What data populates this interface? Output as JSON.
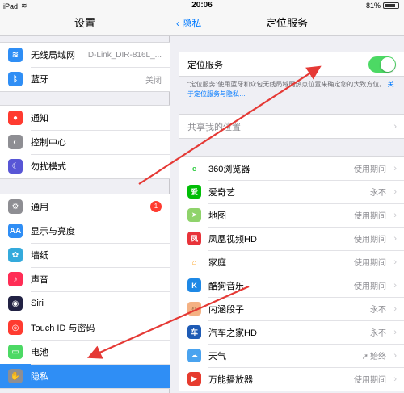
{
  "status": {
    "device": "iPad",
    "time": "20:06",
    "battery": "81%",
    "battery_level": 0.81
  },
  "left": {
    "title": "设置",
    "group1": [
      {
        "name": "wifi",
        "label": "无线局域网",
        "value": "D-Link_DIR-816L_...",
        "color": "#2f8ef5",
        "icon": "wifi-icon",
        "glyph": "≋"
      },
      {
        "name": "bluetooth",
        "label": "蓝牙",
        "value": "关闭",
        "color": "#2f8ef5",
        "icon": "bluetooth-icon",
        "glyph": "ᛒ"
      }
    ],
    "group2": [
      {
        "name": "notifications",
        "label": "通知",
        "color": "#ff3b30",
        "icon": "notifications-icon",
        "glyph": "●"
      },
      {
        "name": "control-center",
        "label": "控制中心",
        "color": "#8e8e93",
        "icon": "control-center-icon",
        "glyph": "◐"
      },
      {
        "name": "do-not-disturb",
        "label": "勿扰模式",
        "color": "#5856d6",
        "icon": "moon-icon",
        "glyph": "☾"
      }
    ],
    "group3": [
      {
        "name": "general",
        "label": "通用",
        "badge": "1",
        "color": "#8e8e93",
        "icon": "gear-icon",
        "glyph": "⚙"
      },
      {
        "name": "display",
        "label": "显示与亮度",
        "color": "#2f8ef5",
        "icon": "display-icon",
        "glyph": "AA"
      },
      {
        "name": "wallpaper",
        "label": "墙纸",
        "color": "#34aadc",
        "icon": "wallpaper-icon",
        "glyph": "✿"
      },
      {
        "name": "sounds",
        "label": "声音",
        "color": "#ff2d55",
        "icon": "sound-icon",
        "glyph": "♪"
      },
      {
        "name": "siri",
        "label": "Siri",
        "color": "#222244",
        "icon": "siri-icon",
        "glyph": "◉"
      },
      {
        "name": "touch-id",
        "label": "Touch ID 与密码",
        "color": "#ff3b30",
        "icon": "fingerprint-icon",
        "glyph": "◎"
      },
      {
        "name": "battery",
        "label": "电池",
        "color": "#4cd964",
        "icon": "battery-icon",
        "glyph": "▭"
      },
      {
        "name": "privacy",
        "label": "隐私",
        "color": "#8e8e93",
        "icon": "hand-icon",
        "glyph": "✋",
        "selected": true
      }
    ]
  },
  "right": {
    "back": "隐私",
    "title": "定位服务",
    "toggle_label": "定位服务",
    "toggle_on": true,
    "desc_text": "“定位服务”使用蓝牙和众包无线局域网热点位置来确定您的大致方位。",
    "desc_link": "关于定位服务与隐私…",
    "share_label": "共享我的位置",
    "apps": [
      {
        "name": "app-360",
        "label": "360浏览器",
        "value": "使用期间",
        "color": "#ffffff",
        "fg": "#2ecc40",
        "glyph": "e",
        "icon": "360-browser-icon"
      },
      {
        "name": "app-iqiyi",
        "label": "爱奇艺",
        "value": "永不",
        "color": "#00be06",
        "fg": "#ffffff",
        "glyph": "爱",
        "icon": "iqiyi-icon"
      },
      {
        "name": "app-maps",
        "label": "地图",
        "value": "使用期间",
        "color": "#8fd36b",
        "fg": "#ffffff",
        "glyph": "➤",
        "icon": "maps-icon"
      },
      {
        "name": "app-ifeng",
        "label": "凤凰视频HD",
        "value": "使用期间",
        "color": "#e8333a",
        "fg": "#ffffff",
        "glyph": "凤",
        "icon": "ifeng-video-icon"
      },
      {
        "name": "app-home",
        "label": "家庭",
        "value": "使用期间",
        "color": "#ffffff",
        "fg": "#ff9500",
        "glyph": "⌂",
        "icon": "home-icon"
      },
      {
        "name": "app-kugou",
        "label": "酷狗音乐",
        "value": "使用期间",
        "color": "#1e88e5",
        "fg": "#ffffff",
        "glyph": "K",
        "icon": "kugou-icon"
      },
      {
        "name": "app-neihan",
        "label": "内涵段子",
        "value": "永不",
        "color": "#f4b183",
        "fg": "#5a3a1a",
        "glyph": "☺",
        "icon": "neihan-icon"
      },
      {
        "name": "app-autohome",
        "label": "汽车之家HD",
        "value": "永不",
        "color": "#1e5bb5",
        "fg": "#ffffff",
        "glyph": "车",
        "icon": "autohome-icon"
      },
      {
        "name": "app-weather",
        "label": "天气",
        "value": "始终",
        "color": "#4aa3ef",
        "fg": "#ffffff",
        "glyph": "☁",
        "icon": "weather-icon",
        "located": true
      },
      {
        "name": "app-player",
        "label": "万能播放器",
        "value": "使用期间",
        "color": "#e63b2e",
        "fg": "#ffffff",
        "glyph": "▶",
        "icon": "player-icon"
      }
    ]
  },
  "colors": {
    "accent": "#007aff",
    "toggle": "#4cd964",
    "annotation_arrow": "#e53935",
    "selected": "#2f8ef5"
  }
}
